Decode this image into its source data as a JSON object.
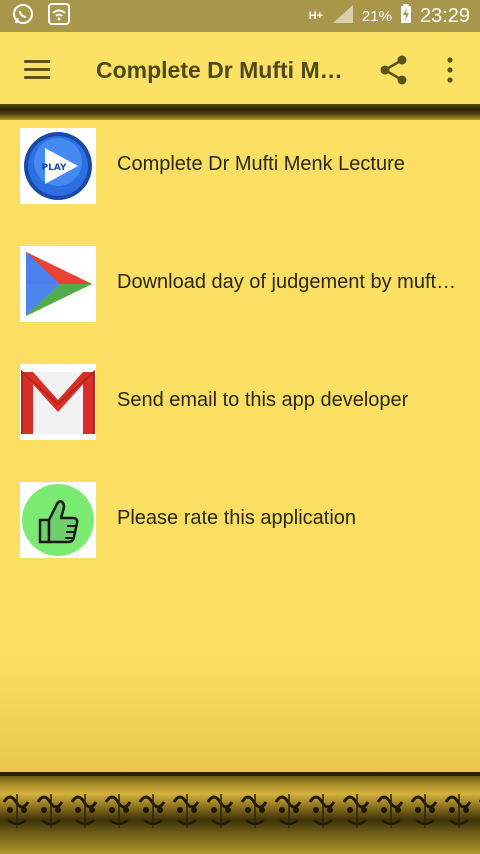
{
  "status_bar": {
    "network": "H+",
    "battery_percent": "21%",
    "time": "23:29",
    "icons": [
      "whatsapp-icon",
      "wifi-icon",
      "signal-icon",
      "battery-charging-icon"
    ]
  },
  "app_bar": {
    "title": "Complete Dr Mufti Menk Lecture",
    "icons": [
      "menu-icon",
      "share-icon",
      "more-vert-icon"
    ]
  },
  "list": {
    "items": [
      {
        "label": "Complete Dr Mufti Menk Lecture",
        "icon": "play-icon"
      },
      {
        "label": "Download day of judgement by mufti menk",
        "icon": "play-store-icon"
      },
      {
        "label": "Send email to this app developer",
        "icon": "gmail-icon"
      },
      {
        "label": "Please rate this application",
        "icon": "thumbs-up-icon"
      }
    ]
  },
  "colors": {
    "background": "#FADF63",
    "status_bar": "#A8974B",
    "title_text": "#4e4a1c"
  }
}
